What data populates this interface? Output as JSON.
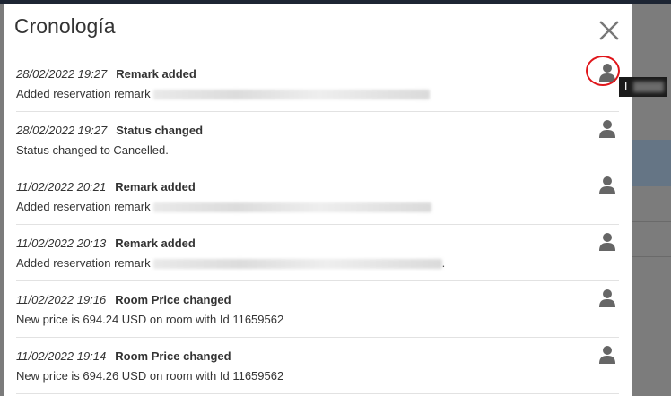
{
  "modal": {
    "title": "Cronología",
    "close_icon": "close-icon"
  },
  "tooltip": {
    "text": "L"
  },
  "entries": [
    {
      "date": "28/02/2022 19:27",
      "type": "Remark added",
      "description": "Added reservation remark",
      "icon": "user-icon"
    },
    {
      "date": "28/02/2022 19:27",
      "type": "Status changed",
      "description": "Status changed to Cancelled.",
      "icon": "user-icon"
    },
    {
      "date": "11/02/2022 20:21",
      "type": "Remark added",
      "description": "Added reservation remark",
      "icon": "user-icon"
    },
    {
      "date": "11/02/2022 20:13",
      "type": "Remark added",
      "description": "Added reservation remark",
      "description_suffix": ".",
      "icon": "user-icon"
    },
    {
      "date": "11/02/2022 19:16",
      "type": "Room Price changed",
      "description": "New price is 694.24 USD on room with Id 11659562",
      "icon": "user-icon"
    },
    {
      "date": "11/02/2022 19:14",
      "type": "Room Price changed",
      "description": "New price is 694.26 USD on room with Id 11659562",
      "icon": "user-icon"
    }
  ],
  "colors": {
    "overlay": "#7b7b7b",
    "highlight_ring": "#e0161b",
    "tooltip_bg": "#1b1b1b",
    "icon": "#666666"
  }
}
